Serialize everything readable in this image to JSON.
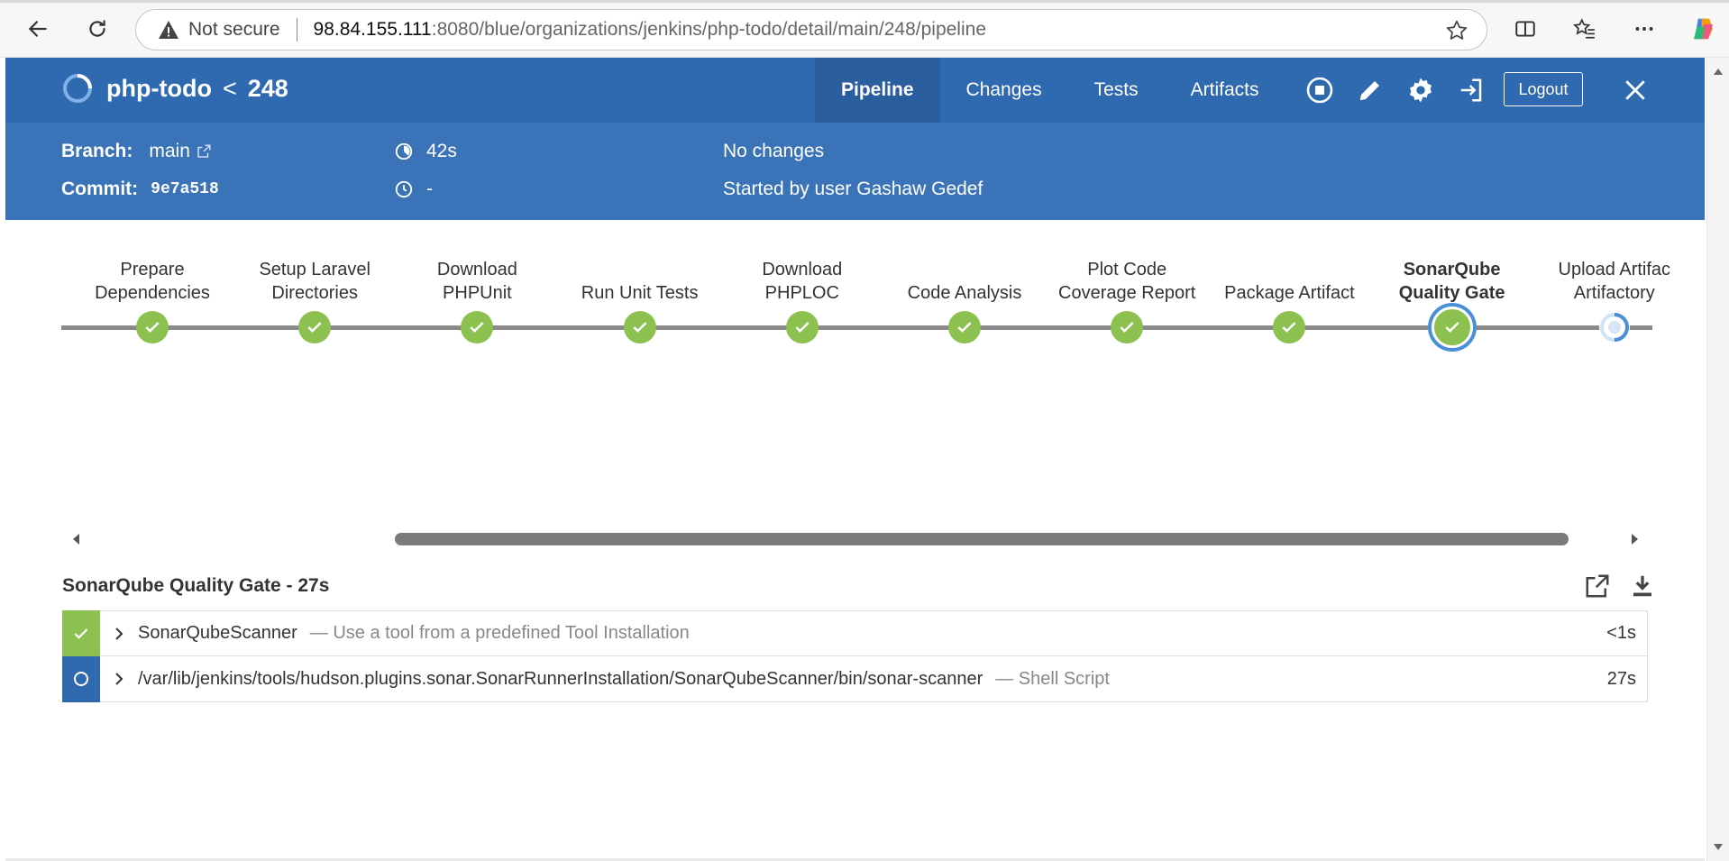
{
  "browser": {
    "not_secure": "Not secure",
    "url_host": "98.84.155.111",
    "url_path": ":8080/blue/organizations/jenkins/php-todo/detail/main/248/pipeline"
  },
  "header": {
    "project": "php-todo",
    "separator": "<",
    "run_number": "248",
    "tabs": [
      {
        "label": "Pipeline",
        "active": true
      },
      {
        "label": "Changes",
        "active": false
      },
      {
        "label": "Tests",
        "active": false
      },
      {
        "label": "Artifacts",
        "active": false
      }
    ],
    "logout": "Logout"
  },
  "summary": {
    "branch_label": "Branch:",
    "branch_value": "main",
    "commit_label": "Commit:",
    "commit_value": "9e7a518",
    "duration": "42s",
    "end_time": "-",
    "changes": "No changes",
    "started_by": "Started by user Gashaw Gedef"
  },
  "pipeline": {
    "stages": [
      {
        "line1": "Prepare",
        "line2": "Dependencies",
        "status": "success"
      },
      {
        "line1": "Setup Laravel",
        "line2": "Directories",
        "status": "success"
      },
      {
        "line1": "Download",
        "line2": "PHPUnit",
        "status": "success"
      },
      {
        "line1": "",
        "line2": "Run Unit Tests",
        "status": "success"
      },
      {
        "line1": "Download",
        "line2": "PHPLOC",
        "status": "success"
      },
      {
        "line1": "",
        "line2": "Code Analysis",
        "status": "success"
      },
      {
        "line1": "Plot Code",
        "line2": "Coverage Report",
        "status": "success"
      },
      {
        "line1": "",
        "line2": "Package Artifact",
        "status": "success"
      },
      {
        "line1": "SonarQube",
        "line2": "Quality Gate",
        "status": "success"
      },
      {
        "line1": "Upload Artifac",
        "line2": "Artifactory",
        "status": "running"
      }
    ]
  },
  "log": {
    "title": "SonarQube Quality Gate - 27s",
    "steps": [
      {
        "name": "SonarQubeScanner",
        "desc": "— Use a tool from a predefined Tool Installation",
        "duration": "<1s",
        "status": "success"
      },
      {
        "name": "/var/lib/jenkins/tools/hudson.plugins.sonar.SonarRunnerInstallation/SonarQubeScanner/bin/sonar-scanner",
        "desc": "— Shell Script",
        "duration": "27s",
        "status": "running"
      }
    ]
  },
  "colors": {
    "header_blue": "#2f69b0",
    "sub_blue": "#3a73b8",
    "success_green": "#8cc04f",
    "running_blue": "#4a90d9"
  }
}
